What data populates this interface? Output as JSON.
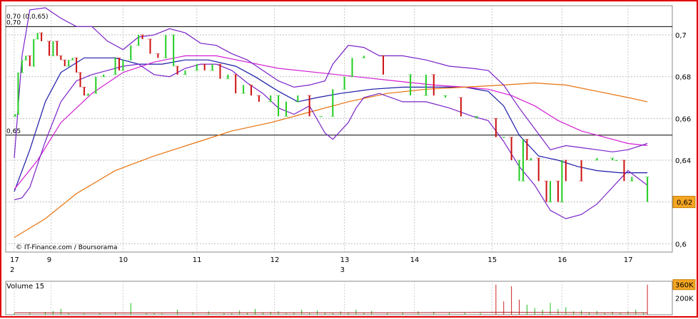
{
  "chart_data": {
    "type": "stock_intraday",
    "credit": "© IT-Finance.com / Boursorama",
    "top_left_label": "0,70 (0,0,65)",
    "ref_levels": [
      {
        "value": 0.704,
        "label": "0,70"
      },
      {
        "value": 0.652,
        "label": "0,65"
      }
    ],
    "y_ticks": [
      "0,7",
      "0,68",
      "0,66",
      "0,64",
      "0,62",
      "0,6"
    ],
    "y_tick_values": [
      0.7,
      0.68,
      0.66,
      0.64,
      0.62,
      0.6
    ],
    "ylim": [
      0.596,
      0.714
    ],
    "last_price": "0,62",
    "last_price_value": 0.62,
    "x_ticks": [
      "17",
      "9",
      "10",
      "11",
      "12",
      "13",
      "14",
      "15",
      "16",
      "17"
    ],
    "x_tick_pos": [
      0,
      9.5,
      28,
      47,
      67,
      85,
      103,
      123,
      141,
      158
    ],
    "month_labels": [
      {
        "text": "2",
        "pos": 0
      },
      {
        "text": "3",
        "pos": 85
      }
    ],
    "x_range": [
      0,
      165
    ],
    "volume_title": "Volume 15",
    "volume_ticks": [
      "360K",
      "200K"
    ],
    "volume_tick_values": [
      360,
      200
    ],
    "volume_max": 400,
    "candles": [
      [
        0.2,
        0.661,
        0.662,
        1
      ],
      [
        1,
        0.662,
        0.682,
        1
      ],
      [
        2,
        0.682,
        0.688,
        1
      ],
      [
        3,
        0.688,
        0.69,
        1
      ],
      [
        4,
        0.69,
        0.685,
        0
      ],
      [
        5,
        0.685,
        0.698,
        1
      ],
      [
        6,
        0.698,
        0.701,
        1
      ],
      [
        7,
        0.701,
        0.697,
        0
      ],
      [
        9,
        0.697,
        0.69,
        0
      ],
      [
        10,
        0.69,
        0.697,
        1
      ],
      [
        11,
        0.697,
        0.69,
        0
      ],
      [
        12,
        0.69,
        0.688,
        0
      ],
      [
        13,
        0.688,
        0.685,
        0
      ],
      [
        14,
        0.685,
        0.688,
        1
      ],
      [
        15,
        0.688,
        0.689,
        1
      ],
      [
        16,
        0.689,
        0.682,
        0
      ],
      [
        17,
        0.682,
        0.675,
        0
      ],
      [
        18,
        0.675,
        0.671,
        0
      ],
      [
        19,
        0.671,
        0.672,
        1
      ],
      [
        21,
        0.672,
        0.68,
        1
      ],
      [
        23,
        0.68,
        0.681,
        1
      ],
      [
        26,
        0.681,
        0.689,
        1
      ],
      [
        27,
        0.689,
        0.683,
        0
      ],
      [
        28,
        0.683,
        0.688,
        1
      ],
      [
        30,
        0.688,
        0.695,
        1
      ],
      [
        32,
        0.695,
        0.7,
        1
      ],
      [
        33,
        0.7,
        0.698,
        0
      ],
      [
        35,
        0.698,
        0.691,
        0
      ],
      [
        37,
        0.691,
        0.689,
        0
      ],
      [
        39,
        0.689,
        0.7,
        1
      ],
      [
        41,
        0.7,
        0.685,
        1
      ],
      [
        42,
        0.685,
        0.681,
        0
      ],
      [
        44,
        0.681,
        0.683,
        1
      ],
      [
        47,
        0.683,
        0.686,
        1
      ],
      [
        49,
        0.686,
        0.683,
        0
      ],
      [
        51,
        0.683,
        0.686,
        1
      ],
      [
        53,
        0.686,
        0.679,
        0
      ],
      [
        55,
        0.679,
        0.681,
        1
      ],
      [
        57,
        0.681,
        0.672,
        0
      ],
      [
        59,
        0.672,
        0.676,
        1
      ],
      [
        61,
        0.676,
        0.671,
        0
      ],
      [
        63,
        0.671,
        0.668,
        0
      ],
      [
        66,
        0.668,
        0.671,
        1
      ],
      [
        68,
        0.671,
        0.661,
        1
      ],
      [
        70,
        0.661,
        0.668,
        1
      ],
      [
        73,
        0.668,
        0.671,
        1
      ],
      [
        76,
        0.671,
        0.661,
        0
      ],
      [
        79,
        0.661,
        0.661,
        1
      ],
      [
        82,
        0.661,
        0.674,
        1
      ],
      [
        85,
        0.674,
        0.68,
        1
      ],
      [
        87,
        0.68,
        0.689,
        1
      ],
      [
        90,
        0.689,
        0.69,
        1
      ],
      [
        95,
        0.69,
        0.681,
        0
      ],
      [
        102,
        0.681,
        0.671,
        1
      ],
      [
        106,
        0.671,
        0.681,
        1
      ],
      [
        108,
        0.681,
        0.671,
        0
      ],
      [
        111,
        0.671,
        0.67,
        1
      ],
      [
        115,
        0.67,
        0.661,
        0
      ],
      [
        119,
        0.661,
        0.66,
        1
      ],
      [
        124,
        0.66,
        0.651,
        0
      ],
      [
        126,
        0.651,
        0.651,
        1
      ],
      [
        128,
        0.651,
        0.64,
        0
      ],
      [
        130,
        0.64,
        0.63,
        1
      ],
      [
        131,
        0.63,
        0.65,
        1
      ],
      [
        132,
        0.65,
        0.64,
        0
      ],
      [
        133,
        0.64,
        0.641,
        1
      ],
      [
        135,
        0.641,
        0.63,
        0
      ],
      [
        137,
        0.63,
        0.62,
        0
      ],
      [
        138,
        0.62,
        0.63,
        1
      ],
      [
        140,
        0.63,
        0.62,
        0
      ],
      [
        141,
        0.62,
        0.64,
        1
      ],
      [
        142,
        0.64,
        0.63,
        0
      ],
      [
        146,
        0.63,
        0.64,
        0
      ],
      [
        150,
        0.64,
        0.641,
        1
      ],
      [
        154,
        0.641,
        0.64,
        1
      ],
      [
        155,
        0.64,
        0.64,
        1
      ],
      [
        157,
        0.64,
        0.63,
        0
      ],
      [
        159,
        0.63,
        0.632,
        1
      ],
      [
        163,
        0.632,
        0.62,
        1
      ]
    ],
    "series": [
      {
        "kind": "ma_short",
        "color": "#1a1aa8",
        "points": [
          [
            0,
            0.625
          ],
          [
            4,
            0.645
          ],
          [
            8,
            0.668
          ],
          [
            12,
            0.682
          ],
          [
            18,
            0.689
          ],
          [
            26,
            0.689
          ],
          [
            32,
            0.686
          ],
          [
            38,
            0.686
          ],
          [
            44,
            0.688
          ],
          [
            50,
            0.688
          ],
          [
            57,
            0.685
          ],
          [
            62,
            0.68
          ],
          [
            68,
            0.673
          ],
          [
            73,
            0.668
          ],
          [
            78,
            0.67
          ],
          [
            84,
            0.672
          ],
          [
            92,
            0.674
          ],
          [
            100,
            0.675
          ],
          [
            108,
            0.675
          ],
          [
            116,
            0.675
          ],
          [
            122,
            0.673
          ],
          [
            126,
            0.666
          ],
          [
            130,
            0.652
          ],
          [
            135,
            0.642
          ],
          [
            140,
            0.64
          ],
          [
            145,
            0.637
          ],
          [
            150,
            0.635
          ],
          [
            156,
            0.634
          ],
          [
            163,
            0.634
          ]
        ]
      },
      {
        "kind": "ma_mid",
        "color": "#d21ed2",
        "points": [
          [
            0,
            0.626
          ],
          [
            6,
            0.64
          ],
          [
            12,
            0.658
          ],
          [
            20,
            0.672
          ],
          [
            28,
            0.682
          ],
          [
            36,
            0.687
          ],
          [
            44,
            0.69
          ],
          [
            52,
            0.69
          ],
          [
            60,
            0.687
          ],
          [
            68,
            0.684
          ],
          [
            78,
            0.682
          ],
          [
            88,
            0.68
          ],
          [
            98,
            0.678
          ],
          [
            108,
            0.676
          ],
          [
            116,
            0.675
          ],
          [
            122,
            0.674
          ],
          [
            128,
            0.671
          ],
          [
            134,
            0.666
          ],
          [
            140,
            0.659
          ],
          [
            146,
            0.654
          ],
          [
            152,
            0.651
          ],
          [
            158,
            0.648
          ],
          [
            163,
            0.647
          ]
        ]
      },
      {
        "kind": "ma_long",
        "color": "#e8720c",
        "points": [
          [
            0,
            0.603
          ],
          [
            8,
            0.612
          ],
          [
            16,
            0.624
          ],
          [
            26,
            0.635
          ],
          [
            36,
            0.642
          ],
          [
            46,
            0.648
          ],
          [
            56,
            0.654
          ],
          [
            66,
            0.658
          ],
          [
            76,
            0.663
          ],
          [
            86,
            0.668
          ],
          [
            96,
            0.672
          ],
          [
            106,
            0.674
          ],
          [
            116,
            0.675
          ],
          [
            126,
            0.676
          ],
          [
            134,
            0.677
          ],
          [
            142,
            0.676
          ],
          [
            150,
            0.673
          ],
          [
            158,
            0.67
          ],
          [
            163,
            0.668
          ]
        ]
      },
      {
        "kind": "boll_upper",
        "color": "#7a22c8",
        "points": [
          [
            0,
            0.641
          ],
          [
            2,
            0.69
          ],
          [
            4,
            0.712
          ],
          [
            8,
            0.713
          ],
          [
            12,
            0.708
          ],
          [
            16,
            0.704
          ],
          [
            20,
            0.704
          ],
          [
            24,
            0.697
          ],
          [
            28,
            0.693
          ],
          [
            32,
            0.699
          ],
          [
            36,
            0.7
          ],
          [
            40,
            0.703
          ],
          [
            44,
            0.701
          ],
          [
            48,
            0.696
          ],
          [
            52,
            0.695
          ],
          [
            56,
            0.691
          ],
          [
            60,
            0.688
          ],
          [
            64,
            0.683
          ],
          [
            68,
            0.678
          ],
          [
            72,
            0.675
          ],
          [
            76,
            0.676
          ],
          [
            80,
            0.678
          ],
          [
            82,
            0.686
          ],
          [
            86,
            0.695
          ],
          [
            90,
            0.694
          ],
          [
            94,
            0.69
          ],
          [
            100,
            0.69
          ],
          [
            106,
            0.688
          ],
          [
            112,
            0.685
          ],
          [
            118,
            0.684
          ],
          [
            122,
            0.683
          ],
          [
            126,
            0.676
          ],
          [
            130,
            0.665
          ],
          [
            134,
            0.655
          ],
          [
            138,
            0.645
          ],
          [
            142,
            0.647
          ],
          [
            146,
            0.646
          ],
          [
            150,
            0.645
          ],
          [
            154,
            0.644
          ],
          [
            158,
            0.645
          ],
          [
            163,
            0.648
          ]
        ]
      },
      {
        "kind": "boll_lower",
        "color": "#7a22c8",
        "points": [
          [
            0,
            0.621
          ],
          [
            2,
            0.622
          ],
          [
            4,
            0.627
          ],
          [
            8,
            0.649
          ],
          [
            12,
            0.668
          ],
          [
            16,
            0.678
          ],
          [
            20,
            0.681
          ],
          [
            24,
            0.683
          ],
          [
            28,
            0.685
          ],
          [
            32,
            0.686
          ],
          [
            36,
            0.681
          ],
          [
            40,
            0.68
          ],
          [
            44,
            0.684
          ],
          [
            48,
            0.686
          ],
          [
            52,
            0.686
          ],
          [
            56,
            0.683
          ],
          [
            60,
            0.677
          ],
          [
            64,
            0.672
          ],
          [
            68,
            0.665
          ],
          [
            72,
            0.662
          ],
          [
            76,
            0.666
          ],
          [
            80,
            0.653
          ],
          [
            82,
            0.65
          ],
          [
            86,
            0.658
          ],
          [
            88,
            0.665
          ],
          [
            90,
            0.67
          ],
          [
            94,
            0.672
          ],
          [
            100,
            0.668
          ],
          [
            106,
            0.668
          ],
          [
            112,
            0.665
          ],
          [
            118,
            0.661
          ],
          [
            122,
            0.659
          ],
          [
            126,
            0.649
          ],
          [
            130,
            0.637
          ],
          [
            134,
            0.628
          ],
          [
            138,
            0.616
          ],
          [
            142,
            0.612
          ],
          [
            146,
            0.614
          ],
          [
            150,
            0.619
          ],
          [
            154,
            0.627
          ],
          [
            158,
            0.635
          ],
          [
            163,
            0.628
          ]
        ]
      }
    ],
    "volumes": [
      [
        0,
        20
      ],
      [
        4,
        30
      ],
      [
        8,
        35
      ],
      [
        10,
        45
      ],
      [
        12,
        70
      ],
      [
        14,
        25
      ],
      [
        18,
        15
      ],
      [
        22,
        20
      ],
      [
        26,
        30
      ],
      [
        30,
        140
      ],
      [
        34,
        25
      ],
      [
        36,
        20
      ],
      [
        38,
        15
      ],
      [
        42,
        60
      ],
      [
        46,
        30
      ],
      [
        50,
        40
      ],
      [
        54,
        20
      ],
      [
        56,
        18
      ],
      [
        58,
        50
      ],
      [
        60,
        25
      ],
      [
        62,
        70
      ],
      [
        64,
        30
      ],
      [
        66,
        35
      ],
      [
        68,
        40
      ],
      [
        70,
        20
      ],
      [
        72,
        30
      ],
      [
        74,
        60
      ],
      [
        76,
        25
      ],
      [
        78,
        50
      ],
      [
        80,
        30
      ],
      [
        82,
        20
      ],
      [
        84,
        40
      ],
      [
        86,
        30
      ],
      [
        88,
        60
      ],
      [
        90,
        25
      ],
      [
        92,
        45
      ],
      [
        96,
        20
      ],
      [
        100,
        30
      ],
      [
        104,
        40
      ],
      [
        108,
        35
      ],
      [
        112,
        25
      ],
      [
        116,
        30
      ],
      [
        120,
        20
      ],
      [
        124,
        360
      ],
      [
        126,
        160
      ],
      [
        128,
        340
      ],
      [
        130,
        180
      ],
      [
        132,
        120
      ],
      [
        134,
        80
      ],
      [
        136,
        60
      ],
      [
        138,
        140
      ],
      [
        140,
        70
      ],
      [
        142,
        90
      ],
      [
        144,
        40
      ],
      [
        146,
        50
      ],
      [
        148,
        30
      ],
      [
        150,
        45
      ],
      [
        152,
        20
      ],
      [
        154,
        35
      ],
      [
        156,
        25
      ],
      [
        158,
        40
      ],
      [
        160,
        60
      ],
      [
        162,
        30
      ],
      [
        163,
        360
      ]
    ],
    "volume_ma": [
      [
        0,
        24
      ],
      [
        20,
        21
      ],
      [
        40,
        22
      ],
      [
        60,
        23
      ],
      [
        80,
        24
      ],
      [
        100,
        24
      ],
      [
        120,
        28
      ],
      [
        126,
        30
      ],
      [
        132,
        28
      ],
      [
        140,
        27
      ],
      [
        150,
        24
      ],
      [
        163,
        23
      ]
    ]
  }
}
